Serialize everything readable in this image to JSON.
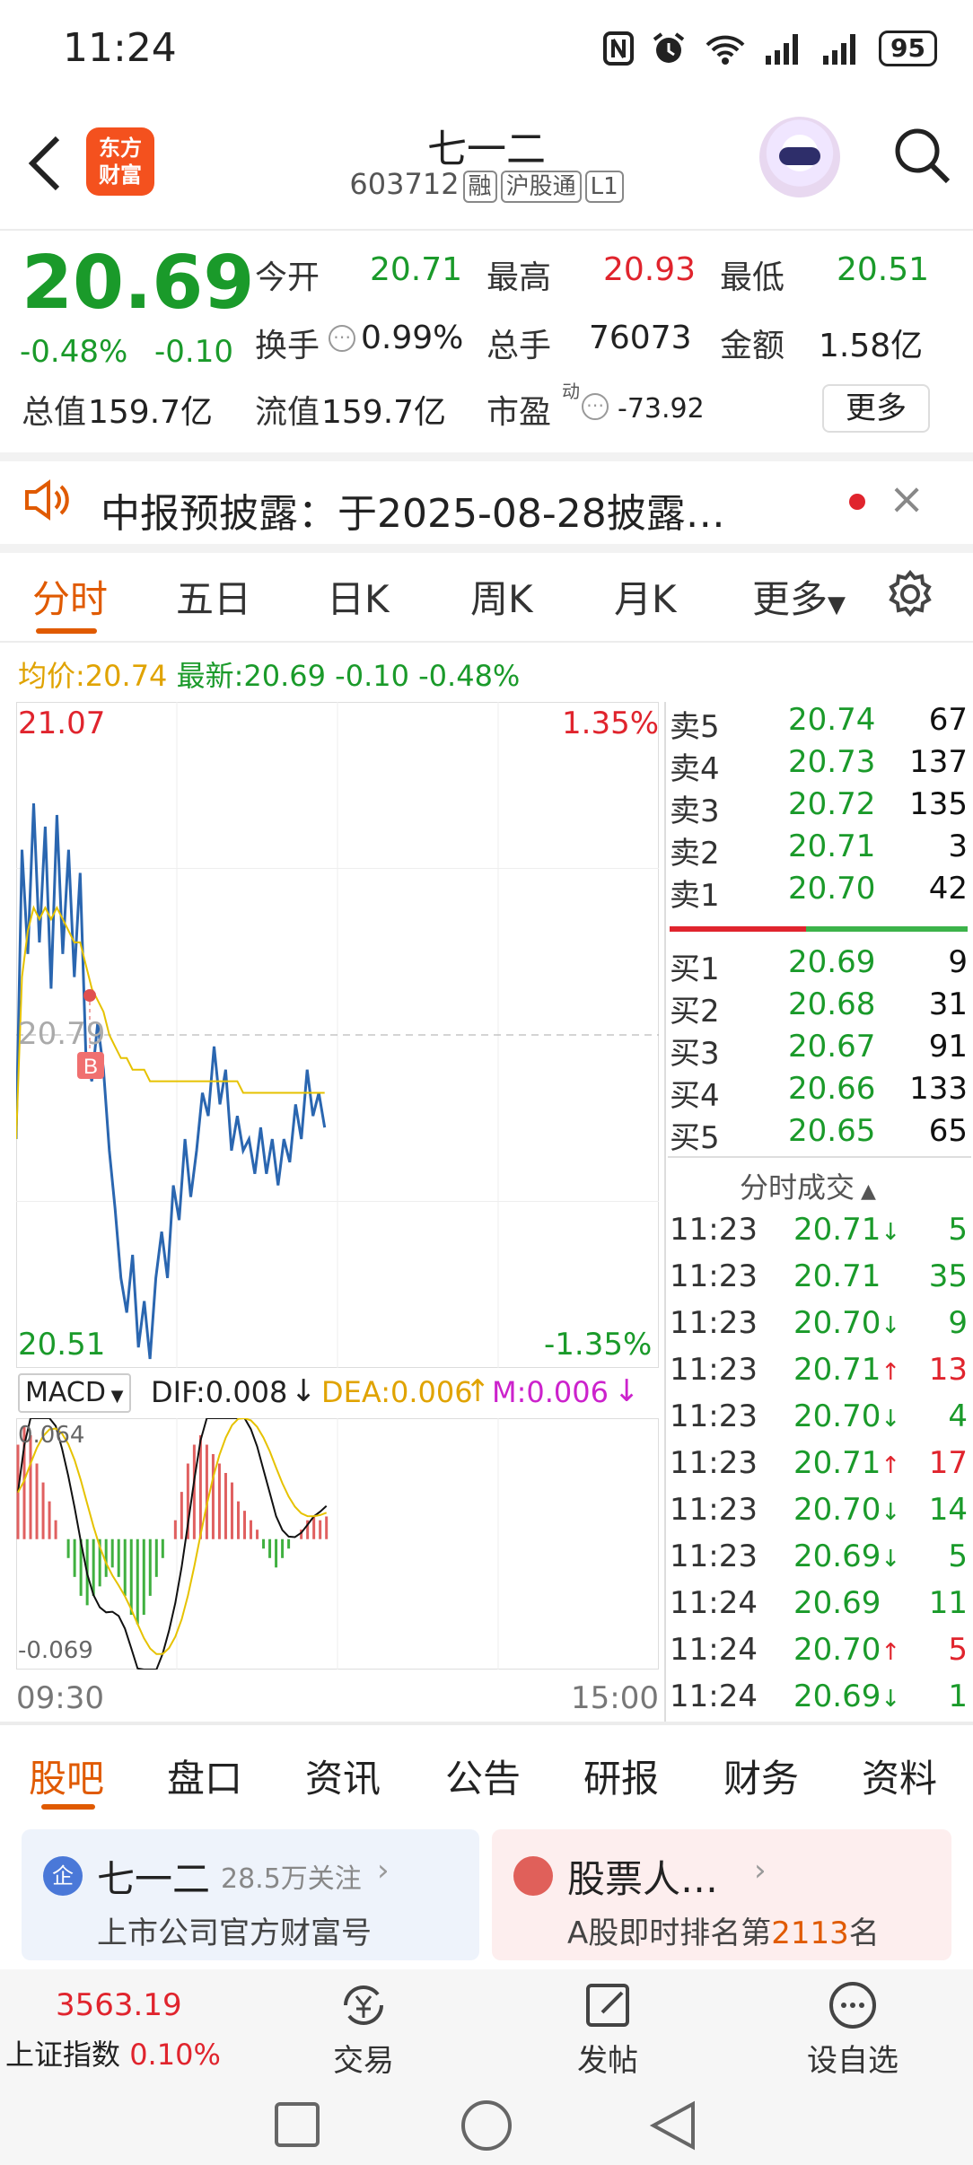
{
  "status_bar": {
    "time": "11:24",
    "battery": "95",
    "icons": [
      "nfc-icon",
      "alarm-icon",
      "wifi-icon",
      "signal-icon",
      "signal-icon",
      "battery-icon"
    ]
  },
  "header": {
    "logo_line1": "东方",
    "logo_line2": "财富",
    "stock_name": "七一二",
    "stock_code": "603712",
    "tags": [
      "融",
      "沪股通",
      "L1"
    ]
  },
  "quote": {
    "price": "20.69",
    "change_pct": "-0.48%",
    "change": "-0.10",
    "open_label": "今开",
    "open": "20.71",
    "high_label": "最高",
    "high": "20.93",
    "low_label": "最低",
    "low": "20.51",
    "turnover_label": "换手",
    "turnover": "0.99%",
    "volume_label": "总手",
    "volume": "76073",
    "amount_label": "金额",
    "amount": "1.58亿",
    "mktcap_label": "总值",
    "mktcap": "159.7亿",
    "float_label": "流值",
    "float": "159.7亿",
    "pe_label": "市盈",
    "pe_sup": "动",
    "pe": "-73.92",
    "more_label": "更多"
  },
  "notice": {
    "text": "中报预披露：于2025-08-28披露…",
    "close": "×"
  },
  "chart_tabs": [
    "分时",
    "五日",
    "日K",
    "周K",
    "月K",
    "更多"
  ],
  "legend": {
    "avg_label": "均价:",
    "avg": "20.74",
    "latest_label": "最新:",
    "latest": "20.69",
    "change": "-0.10",
    "pct": "-0.48%"
  },
  "chart_data": [
    {
      "type": "line",
      "title": "分时",
      "x_range": [
        "09:30",
        "15:00"
      ],
      "ylim": [
        20.51,
        21.07
      ],
      "y_labels": {
        "top": "21.07",
        "bottom": "20.51",
        "mid": "20.79",
        "top_pct": "1.35%",
        "bottom_pct": "-1.35%"
      },
      "series": [
        {
          "name": "price",
          "color": "#2a66b0",
          "values": [
            20.7,
            20.95,
            20.86,
            20.99,
            20.87,
            20.97,
            20.83,
            20.98,
            20.86,
            20.95,
            20.84,
            20.93,
            20.77,
            20.75,
            20.8,
            20.76,
            20.69,
            20.64,
            20.58,
            20.55,
            20.6,
            20.52,
            20.56,
            20.51,
            20.58,
            20.62,
            20.58,
            20.66,
            20.63,
            20.7,
            20.65,
            20.69,
            20.74,
            20.72,
            20.78,
            20.73,
            20.76,
            20.69,
            20.72,
            20.69,
            20.7,
            20.67,
            20.71,
            20.67,
            20.7,
            20.66,
            20.7,
            20.68,
            20.73,
            20.7,
            20.76,
            20.72,
            20.74,
            20.71
          ]
        },
        {
          "name": "均价",
          "color": "#e6c200",
          "values": [
            20.7,
            20.84,
            20.88,
            20.9,
            20.89,
            20.9,
            20.89,
            20.9,
            20.89,
            20.88,
            20.87,
            20.87,
            20.85,
            20.83,
            20.82,
            20.81,
            20.79,
            20.78,
            20.77,
            20.77,
            20.76,
            20.76,
            20.76,
            20.75,
            20.75,
            20.75,
            20.75,
            20.75,
            20.75,
            20.75,
            20.75,
            20.75,
            20.75,
            20.75,
            20.75,
            20.75,
            20.75,
            20.75,
            20.75,
            20.74,
            20.74,
            20.74,
            20.74,
            20.74,
            20.74,
            20.74,
            20.74,
            20.74,
            20.74,
            20.74,
            20.74,
            20.74,
            20.74,
            20.74
          ]
        }
      ],
      "buy_marker": "B"
    },
    {
      "type": "bar",
      "title": "MACD",
      "ylim": [
        -0.069,
        0.064
      ],
      "y_labels": {
        "top": "0.064",
        "bottom": "-0.069"
      },
      "legend": {
        "selector": "MACD",
        "dif": "DIF:0.008",
        "dea": "DEA:0.006",
        "m": "M:0.006"
      },
      "values": [
        0.05,
        0.06,
        0.055,
        0.04,
        0.03,
        0.02,
        0.01,
        0.0,
        -0.01,
        -0.02,
        -0.03,
        -0.035,
        -0.03,
        -0.025,
        -0.02,
        -0.015,
        -0.02,
        -0.03,
        -0.04,
        -0.045,
        -0.04,
        -0.03,
        -0.02,
        -0.01,
        0.0,
        0.01,
        0.025,
        0.04,
        0.05,
        0.055,
        0.05,
        0.045,
        0.04,
        0.035,
        0.03,
        0.02,
        0.015,
        0.01,
        0.005,
        -0.005,
        -0.01,
        -0.015,
        -0.01,
        -0.005,
        0.0,
        0.005,
        0.01,
        0.012,
        0.01,
        0.012
      ]
    }
  ],
  "time_axis": {
    "start": "09:30",
    "end": "15:00"
  },
  "order_book": {
    "asks": [
      {
        "label": "卖5",
        "price": "20.74",
        "vol": "67"
      },
      {
        "label": "卖4",
        "price": "20.73",
        "vol": "137"
      },
      {
        "label": "卖3",
        "price": "20.72",
        "vol": "135"
      },
      {
        "label": "卖2",
        "price": "20.71",
        "vol": "3"
      },
      {
        "label": "卖1",
        "price": "20.70",
        "vol": "42"
      }
    ],
    "bids": [
      {
        "label": "买1",
        "price": "20.69",
        "vol": "9"
      },
      {
        "label": "买2",
        "price": "20.68",
        "vol": "31"
      },
      {
        "label": "买3",
        "price": "20.67",
        "vol": "91"
      },
      {
        "label": "买4",
        "price": "20.66",
        "vol": "133"
      },
      {
        "label": "买5",
        "price": "20.65",
        "vol": "65"
      }
    ]
  },
  "ticks": {
    "title": "分时成交",
    "rows": [
      {
        "time": "11:23",
        "price": "20.71",
        "arrow": "↓",
        "vol": "5",
        "dir": "down"
      },
      {
        "time": "11:23",
        "price": "20.71",
        "arrow": "",
        "vol": "35",
        "dir": "down"
      },
      {
        "time": "11:23",
        "price": "20.70",
        "arrow": "↓",
        "vol": "9",
        "dir": "down"
      },
      {
        "time": "11:23",
        "price": "20.71",
        "arrow": "↑",
        "vol": "13",
        "dir": "up"
      },
      {
        "time": "11:23",
        "price": "20.70",
        "arrow": "↓",
        "vol": "4",
        "dir": "down"
      },
      {
        "time": "11:23",
        "price": "20.71",
        "arrow": "↑",
        "vol": "17",
        "dir": "up"
      },
      {
        "time": "11:23",
        "price": "20.70",
        "arrow": "↓",
        "vol": "14",
        "dir": "down"
      },
      {
        "time": "11:23",
        "price": "20.69",
        "arrow": "↓",
        "vol": "5",
        "dir": "down"
      },
      {
        "time": "11:24",
        "price": "20.69",
        "arrow": "",
        "vol": "11",
        "dir": "down"
      },
      {
        "time": "11:24",
        "price": "20.70",
        "arrow": "↑",
        "vol": "5",
        "dir": "up"
      },
      {
        "time": "11:24",
        "price": "20.69",
        "arrow": "↓",
        "vol": "1",
        "dir": "down"
      }
    ]
  },
  "bottom_tabs": [
    "股吧",
    "盘口",
    "资讯",
    "公告",
    "研报",
    "财务",
    "资料"
  ],
  "cards": {
    "card1": {
      "badge": "企",
      "name": "七一二",
      "follow": "28.5万关注",
      "desc": "上市公司官方财富号"
    },
    "card2": {
      "name": "股票人…",
      "desc_pre": "A股即时排名第",
      "rank": "2113",
      "desc_post": "名"
    }
  },
  "bottom_nav": {
    "index_value": "3563.19",
    "index_name": "上证指数",
    "index_pct": "0.10%",
    "trade": "交易",
    "post": "发帖",
    "watch": "设自选"
  }
}
